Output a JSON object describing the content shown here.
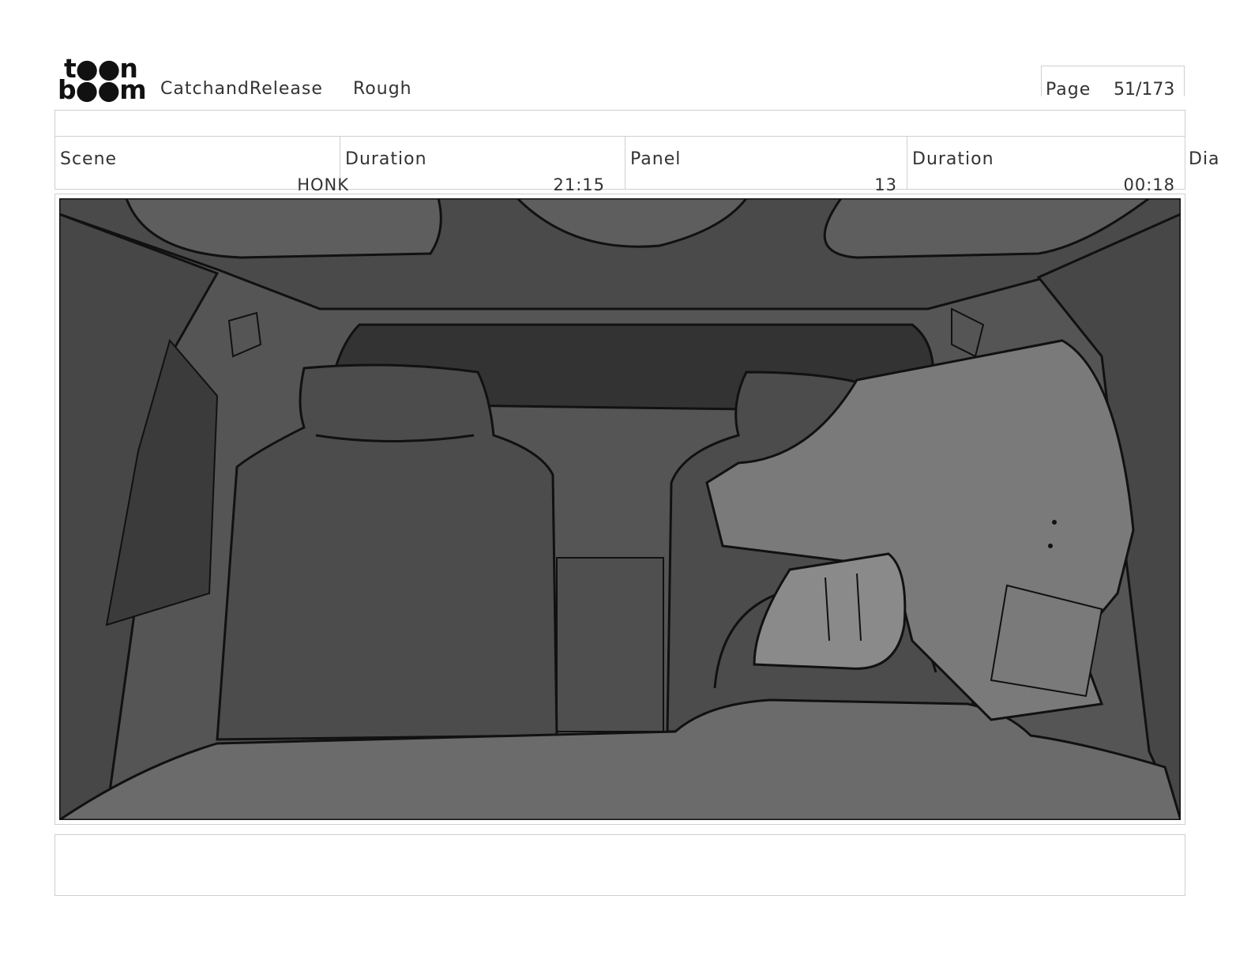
{
  "header": {
    "logo_top": "t●●n",
    "logo_bottom": "b●●m",
    "project_name": "CatchandRelease",
    "stage": "Rough",
    "page_label": "Page",
    "page_value": "51/173"
  },
  "info": {
    "scene_label": "Scene",
    "scene_value": "HONK",
    "scene_duration_label": "Duration",
    "scene_duration_value": "21:15",
    "panel_label": "Panel",
    "panel_value": "13",
    "panel_duration_label": "Duration",
    "panel_duration_value": "00:18",
    "dialogue_label": "Dia"
  },
  "colors": {
    "border": "#cfcfcf",
    "ink": "#111111",
    "interior_dark": "#3a3a3a",
    "interior_mid": "#4d4d4d",
    "interior_light": "#6b6b6b",
    "character": "#8a8a8a"
  }
}
